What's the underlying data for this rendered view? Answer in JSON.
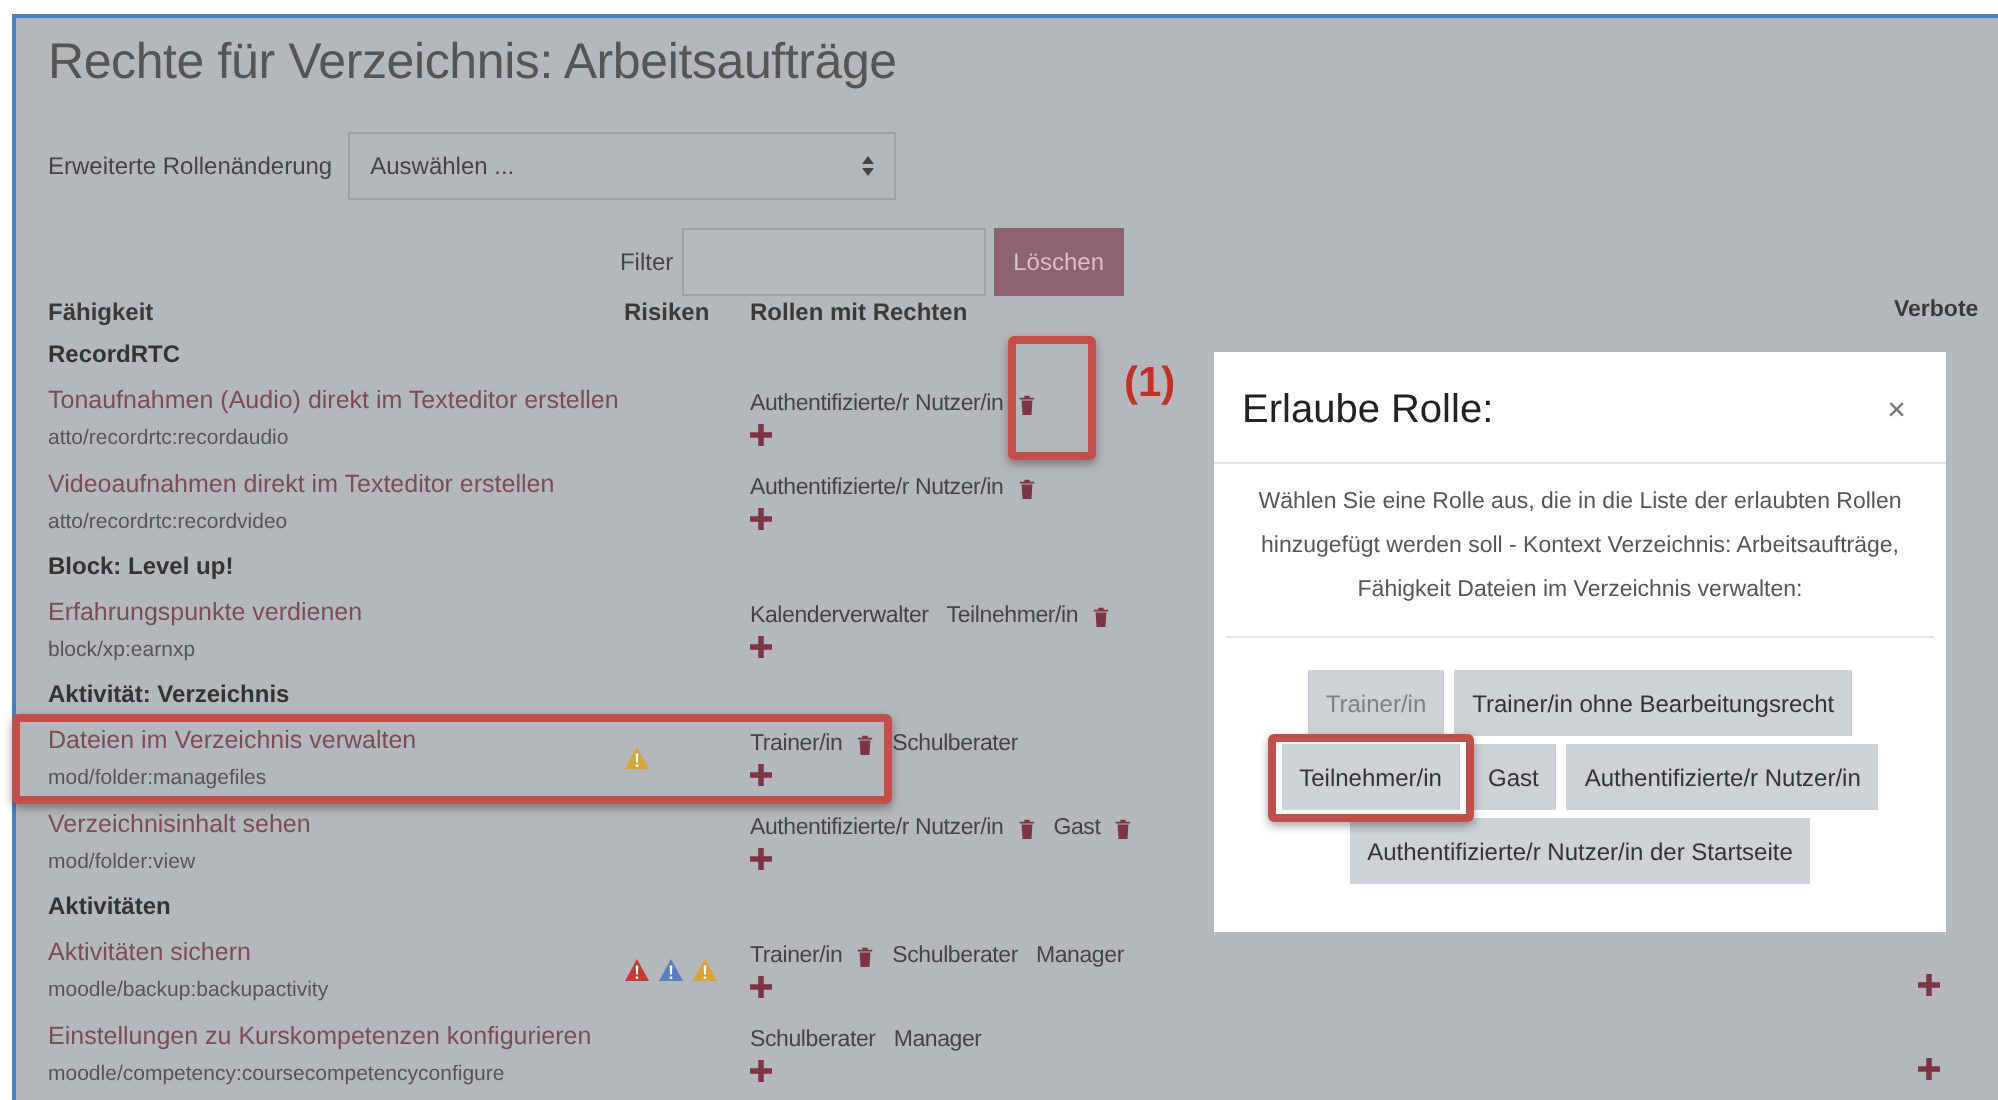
{
  "page": {
    "title": "Rechte für Verzeichnis: Arbeitsaufträge"
  },
  "role_change": {
    "label": "Erweiterte Rollenänderung",
    "value": "Auswählen ..."
  },
  "filter": {
    "label": "Filter",
    "button": "Löschen"
  },
  "table": {
    "columns": [
      "Fähigkeit",
      "Risiken",
      "Rollen mit Rechten",
      "Verbote"
    ],
    "sections": [
      {
        "heading": "RecordRTC",
        "rows": [
          {
            "name": "Tonaufnahmen (Audio) direkt im Texteditor erstellen",
            "code": "atto/recordrtc:recordaudio",
            "risks": [],
            "roles": [
              {
                "name": "Authentifizierte/r Nutzer/in",
                "removable": true
              }
            ]
          },
          {
            "name": "Videoaufnahmen direkt im Texteditor erstellen",
            "code": "atto/recordrtc:recordvideo",
            "risks": [],
            "roles": [
              {
                "name": "Authentifizierte/r Nutzer/in",
                "removable": true
              }
            ]
          }
        ]
      },
      {
        "heading": "Block: Level up!",
        "rows": [
          {
            "name": "Erfahrungspunkte verdienen",
            "code": "block/xp:earnxp",
            "risks": [],
            "roles": [
              {
                "name": "Kalenderverwalter",
                "removable": false
              },
              {
                "name": "Teilnehmer/in",
                "removable": true
              }
            ]
          }
        ]
      },
      {
        "heading": "Aktivität: Verzeichnis",
        "rows": [
          {
            "name": "Dateien im Verzeichnis verwalten",
            "code": "mod/folder:managefiles",
            "risks": [
              {
                "color": "#d9a437"
              }
            ],
            "roles": [
              {
                "name": "Trainer/in",
                "removable": true
              },
              {
                "name": "Schulberater",
                "removable": false
              }
            ]
          },
          {
            "name": "Verzeichnisinhalt sehen",
            "code": "mod/folder:view",
            "risks": [],
            "roles": [
              {
                "name": "Authentifizierte/r Nutzer/in",
                "removable": true
              },
              {
                "name": "Gast",
                "removable": true
              }
            ]
          }
        ]
      },
      {
        "heading": "Aktivitäten",
        "rows": [
          {
            "name": "Aktivitäten sichern",
            "code": "moodle/backup:backupactivity",
            "risks": [
              {
                "color": "#c23b3b"
              },
              {
                "color": "#5b7fc0"
              },
              {
                "color": "#d9a437"
              }
            ],
            "roles": [
              {
                "name": "Trainer/in",
                "removable": true
              },
              {
                "name": "Schulberater",
                "removable": false
              },
              {
                "name": "Manager",
                "removable": false
              }
            ],
            "prohibit_add": true
          },
          {
            "name": "Einstellungen zu Kurskompetenzen konfigurieren",
            "code": "moodle/competency:coursecompetencyconfigure",
            "risks": [],
            "roles": [
              {
                "name": "Schulberater",
                "removable": false
              },
              {
                "name": "Manager",
                "removable": false
              }
            ],
            "prohibit_add": true
          }
        ]
      }
    ]
  },
  "dialog": {
    "title": "Erlaube Rolle:",
    "close": "×",
    "text": "Wählen Sie eine Rolle aus, die in die Liste der erlaubten Rollen hinzugefügt werden soll - Kontext Verzeichnis: Arbeitsaufträge, Fähigkeit Dateien im Verzeichnis verwalten:",
    "roles": [
      {
        "label": "Trainer/in",
        "disabled": true
      },
      {
        "label": "Trainer/in ohne Bearbeitungsrecht",
        "disabled": false
      },
      {
        "label": "Teilnehmer/in",
        "disabled": false
      },
      {
        "label": "Gast",
        "disabled": false
      },
      {
        "label": "Authentifizierte/r Nutzer/in",
        "disabled": false
      },
      {
        "label": "Authentifizierte/r Nutzer/in der Startseite",
        "disabled": false
      }
    ]
  },
  "annotation": {
    "label": "(1)"
  }
}
